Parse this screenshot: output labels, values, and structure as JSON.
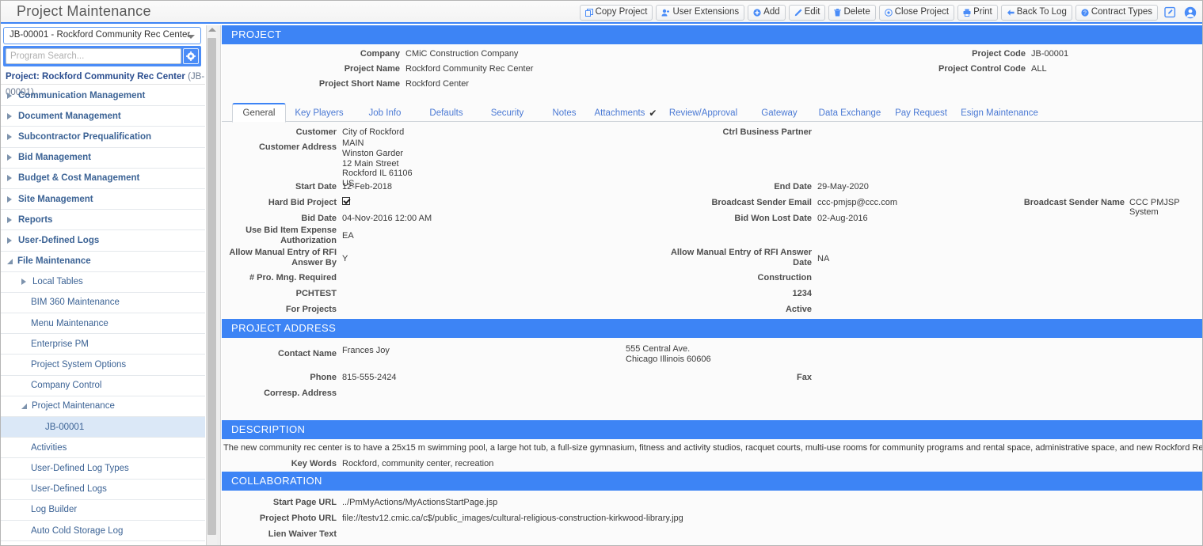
{
  "app": {
    "title": "Project Maintenance"
  },
  "toolbar": {
    "buttons": [
      {
        "label": "Copy Project",
        "icon": "copy-icon"
      },
      {
        "label": "User Extensions",
        "icon": "user-plus-icon"
      },
      {
        "label": "Add",
        "icon": "plus-circle-icon"
      },
      {
        "label": "Edit",
        "icon": "pencil-icon"
      },
      {
        "label": "Delete",
        "icon": "trash-icon"
      },
      {
        "label": "Close Project",
        "icon": "close-circle-icon"
      },
      {
        "label": "Print",
        "icon": "printer-icon"
      },
      {
        "label": "Back To Log",
        "icon": "arrow-left-icon"
      },
      {
        "label": "Contract Types",
        "icon": "question-circle-icon"
      }
    ]
  },
  "sidebar": {
    "project_select_value": "JB-00001 - Rockford Community Rec Center",
    "search_placeholder": "Program Search...",
    "project_line_label": "Project: Rockford Community Rec Center",
    "project_line_code": "(JB-00001)",
    "tree": [
      {
        "label": "Communication Management",
        "level": 0,
        "state": "collapsed"
      },
      {
        "label": "Document Management",
        "level": 0,
        "state": "collapsed"
      },
      {
        "label": "Subcontractor Prequalification",
        "level": 0,
        "state": "collapsed"
      },
      {
        "label": "Bid Management",
        "level": 0,
        "state": "collapsed"
      },
      {
        "label": "Budget & Cost Management",
        "level": 0,
        "state": "collapsed"
      },
      {
        "label": "Site Management",
        "level": 0,
        "state": "collapsed"
      },
      {
        "label": "Reports",
        "level": 0,
        "state": "collapsed"
      },
      {
        "label": "User-Defined Logs",
        "level": 0,
        "state": "collapsed"
      },
      {
        "label": "File Maintenance",
        "level": 0,
        "state": "expanded"
      },
      {
        "label": "Local Tables",
        "level": 1,
        "state": "collapsed"
      },
      {
        "label": "BIM 360 Maintenance",
        "level": 2,
        "state": "leaf"
      },
      {
        "label": "Menu Maintenance",
        "level": 2,
        "state": "leaf"
      },
      {
        "label": "Enterprise PM",
        "level": 2,
        "state": "leaf"
      },
      {
        "label": "Project System Options",
        "level": 2,
        "state": "leaf"
      },
      {
        "label": "Company Control",
        "level": 2,
        "state": "leaf"
      },
      {
        "label": "Project Maintenance",
        "level": 1,
        "state": "expanded"
      },
      {
        "label": "JB-00001",
        "level": 3,
        "state": "leaf",
        "selected": true
      },
      {
        "label": "Activities",
        "level": 2,
        "state": "leaf"
      },
      {
        "label": "User-Defined Log Types",
        "level": 2,
        "state": "leaf"
      },
      {
        "label": "User-Defined Logs",
        "level": 2,
        "state": "leaf"
      },
      {
        "label": "Log Builder",
        "level": 2,
        "state": "leaf"
      },
      {
        "label": "Auto Cold Storage Log",
        "level": 2,
        "state": "leaf"
      }
    ]
  },
  "sections": {
    "project": "PROJECT",
    "project_address": "PROJECT ADDRESS",
    "description": "DESCRIPTION",
    "collaboration": "COLLABORATION"
  },
  "header": {
    "company_label": "Company",
    "company_value": "CMiC Construction Company",
    "project_name_label": "Project Name",
    "project_name_value": "Rockford Community Rec Center",
    "project_short_name_label": "Project Short Name",
    "project_short_name_value": "Rockford Center",
    "project_code_label": "Project Code",
    "project_code_value": "JB-00001",
    "project_control_code_label": "Project Control Code",
    "project_control_code_value": "ALL"
  },
  "tabs": [
    {
      "label": "General",
      "active": true
    },
    {
      "label": "Key Players",
      "active": false
    },
    {
      "label": "Job Info",
      "active": false
    },
    {
      "label": "Defaults",
      "active": false
    },
    {
      "label": "Security",
      "active": false
    },
    {
      "label": "Notes",
      "active": false
    },
    {
      "label": "Attachments",
      "active": false,
      "checkmark": "✔"
    },
    {
      "label": "Review/Approval",
      "active": false
    },
    {
      "label": "Gateway",
      "active": false
    },
    {
      "label": "Data Exchange",
      "active": false
    },
    {
      "label": "Pay Request",
      "active": false
    },
    {
      "label": "Esign Maintenance",
      "active": false
    }
  ],
  "general": {
    "customer_label": "Customer",
    "customer_value": "City of Rockford",
    "customer_address_label": "Customer Address",
    "customer_address_value": "MAIN\nWinston Garder\n12 Main Street\nRockford IL 61106\nUS",
    "start_date_label": "Start Date",
    "start_date_value": "12-Feb-2018",
    "hard_bid_label": "Hard Bid Project",
    "hard_bid_checked": true,
    "bid_date_label": "Bid Date",
    "bid_date_value": "04-Nov-2016 12:00 AM",
    "use_bid_item_label": "Use Bid Item Expense Authorization",
    "use_bid_item_value": "EA",
    "rfi_answer_by_label": "Allow Manual Entry of RFI Answer By",
    "rfi_answer_by_value": "Y",
    "pro_mng_label": "# Pro. Mng. Required",
    "pro_mng_value": "",
    "pchtest_label": "PCHTEST",
    "pchtest_value": "",
    "for_projects_label": "For Projects",
    "for_projects_value": "",
    "ctrl_business_partner_label": "Ctrl Business Partner",
    "ctrl_business_partner_value": "",
    "end_date_label": "End Date",
    "end_date_value": "29-May-2020",
    "broadcast_email_label": "Broadcast Sender Email",
    "broadcast_email_value": "ccc-pmjsp@ccc.com",
    "bid_won_lost_label": "Bid Won Lost Date",
    "bid_won_lost_value": "02-Aug-2016",
    "rfi_answer_date_label": "Allow Manual Entry of RFI Answer Date",
    "rfi_answer_date_value": "NA",
    "construction_label": "Construction",
    "construction_value": "",
    "number_label": "1234",
    "number_value": "",
    "active_label": "Active",
    "active_value": "",
    "broadcast_sender_name_label": "Broadcast Sender Name",
    "broadcast_sender_name_value": "CCC PMJSP System"
  },
  "address": {
    "contact_name_label": "Contact Name",
    "contact_name_value": "Frances Joy",
    "address_value": "555 Central Ave.\nChicago Illinois 60606",
    "phone_label": "Phone",
    "phone_value": "815-555-2424",
    "fax_label": "Fax",
    "fax_value": "",
    "corresp_address_label": "Corresp. Address",
    "corresp_address_value": ""
  },
  "description": {
    "text": "The new community rec center is to have a 25x15 m swimming pool, a large hot tub, a full-size gymnasium, fitness and activity studios, racquet courts, multi-use rooms for community programs and rental space, administrative space, and new Rockford Recreation offices.",
    "keywords_label": "Key Words",
    "keywords_value": "Rockford, community center, recreation"
  },
  "collaboration": {
    "start_page_url_label": "Start Page URL",
    "start_page_url_value": "../PmMyActions/MyActionsStartPage.jsp",
    "project_photo_url_label": "Project Photo URL",
    "project_photo_url_value": "file://testv12.cmic.ca/c$/public_images/cultural-religious-construction-kirkwood-library.jpg",
    "lien_waiver_label": "Lien Waiver Text",
    "lien_waiver_value": ""
  },
  "colors": {
    "accent": "#3d84f5",
    "link": "#4a79d4",
    "selected_row": "#dbe8f7"
  }
}
